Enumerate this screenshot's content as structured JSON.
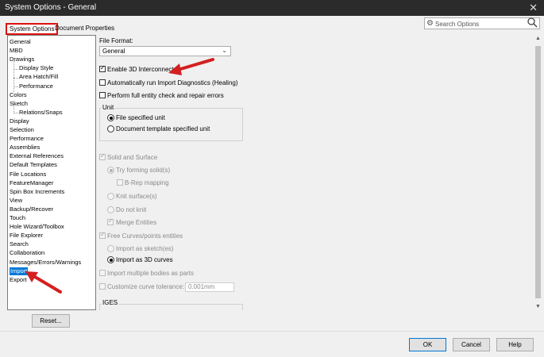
{
  "window": {
    "title": "System Options - General",
    "close_label": "✕"
  },
  "tabs": [
    {
      "label": "System Options",
      "active": true
    },
    {
      "label": "Document Properties",
      "active": false
    }
  ],
  "search": {
    "placeholder": "Search Options",
    "icon_left": "gear-icon",
    "icon_right": "magnifier-icon"
  },
  "tree": {
    "items": [
      {
        "label": "General",
        "indent": 0
      },
      {
        "label": "MBD",
        "indent": 0
      },
      {
        "label": "Drawings",
        "indent": 0
      },
      {
        "label": "Display Style",
        "indent": 1
      },
      {
        "label": "Area Hatch/Fill",
        "indent": 1
      },
      {
        "label": "Performance",
        "indent": 1
      },
      {
        "label": "Colors",
        "indent": 0
      },
      {
        "label": "Sketch",
        "indent": 0
      },
      {
        "label": "Relations/Snaps",
        "indent": 1
      },
      {
        "label": "Display",
        "indent": 0
      },
      {
        "label": "Selection",
        "indent": 0
      },
      {
        "label": "Performance",
        "indent": 0
      },
      {
        "label": "Assemblies",
        "indent": 0
      },
      {
        "label": "External References",
        "indent": 0
      },
      {
        "label": "Default Templates",
        "indent": 0
      },
      {
        "label": "File Locations",
        "indent": 0
      },
      {
        "label": "FeatureManager",
        "indent": 0
      },
      {
        "label": "Spin Box Increments",
        "indent": 0
      },
      {
        "label": "View",
        "indent": 0
      },
      {
        "label": "Backup/Recover",
        "indent": 0
      },
      {
        "label": "Touch",
        "indent": 0
      },
      {
        "label": "Hole Wizard/Toolbox",
        "indent": 0
      },
      {
        "label": "File Explorer",
        "indent": 0
      },
      {
        "label": "Search",
        "indent": 0
      },
      {
        "label": "Collaboration",
        "indent": 0
      },
      {
        "label": "Messages/Errors/Warnings",
        "indent": 0
      },
      {
        "label": "Import",
        "indent": 0,
        "selected": true
      },
      {
        "label": "Export",
        "indent": 0
      }
    ]
  },
  "reset_label": "Reset...",
  "panel": {
    "file_format_label": "File Format:",
    "file_format_value": "General",
    "enable_3d_interconnect": {
      "label": "Enable 3D Interconnect",
      "checked": true
    },
    "auto_import_diagnostics": {
      "label": "Automatically run Import Diagnostics (Healing)",
      "checked": false
    },
    "full_entity_check": {
      "label": "Perform full entity check and repair errors",
      "checked": false
    },
    "unit_group": {
      "title": "Unit",
      "options": [
        {
          "label": "File specified unit",
          "selected": true
        },
        {
          "label": "Document template specified unit",
          "selected": false
        }
      ]
    },
    "solid_and_surface": {
      "label": "Solid and Surface",
      "checked": true,
      "disabled": true
    },
    "try_forming_solids": {
      "label": "Try forming solid(s)",
      "selected": true,
      "disabled": true
    },
    "brep_mapping": {
      "label": "B-Rep mapping",
      "checked": false,
      "disabled": true
    },
    "knit_surfaces": {
      "label": "Knit surface(s)",
      "selected": false,
      "disabled": true
    },
    "do_not_knit": {
      "label": "Do not knit",
      "selected": false,
      "disabled": true
    },
    "merge_entities": {
      "label": "Merge Entities",
      "checked": true,
      "disabled": true
    },
    "free_curves": {
      "label": "Free Curves/points entities",
      "checked": true,
      "disabled": true
    },
    "import_as_sketches": {
      "label": "Import as sketch(es)",
      "selected": false,
      "disabled": true
    },
    "import_as_3d_curves": {
      "label": "Import as 3D curves",
      "selected": true,
      "disabled": false
    },
    "import_multiple_bodies": {
      "label": "Import multiple bodies as parts",
      "checked": false,
      "disabled": true
    },
    "customize_tolerance": {
      "label": "Customize curve tolerance:",
      "checked": false,
      "disabled": true,
      "value": "0.001mm"
    },
    "iges_group_title": "IGES"
  },
  "buttons": {
    "ok": "OK",
    "cancel": "Cancel",
    "help": "Help"
  },
  "colors": {
    "titlebar": "#2b2b2b",
    "selection": "#0078d7",
    "annotation_arrow": "#d32020",
    "highlight_box": "#d11111"
  }
}
